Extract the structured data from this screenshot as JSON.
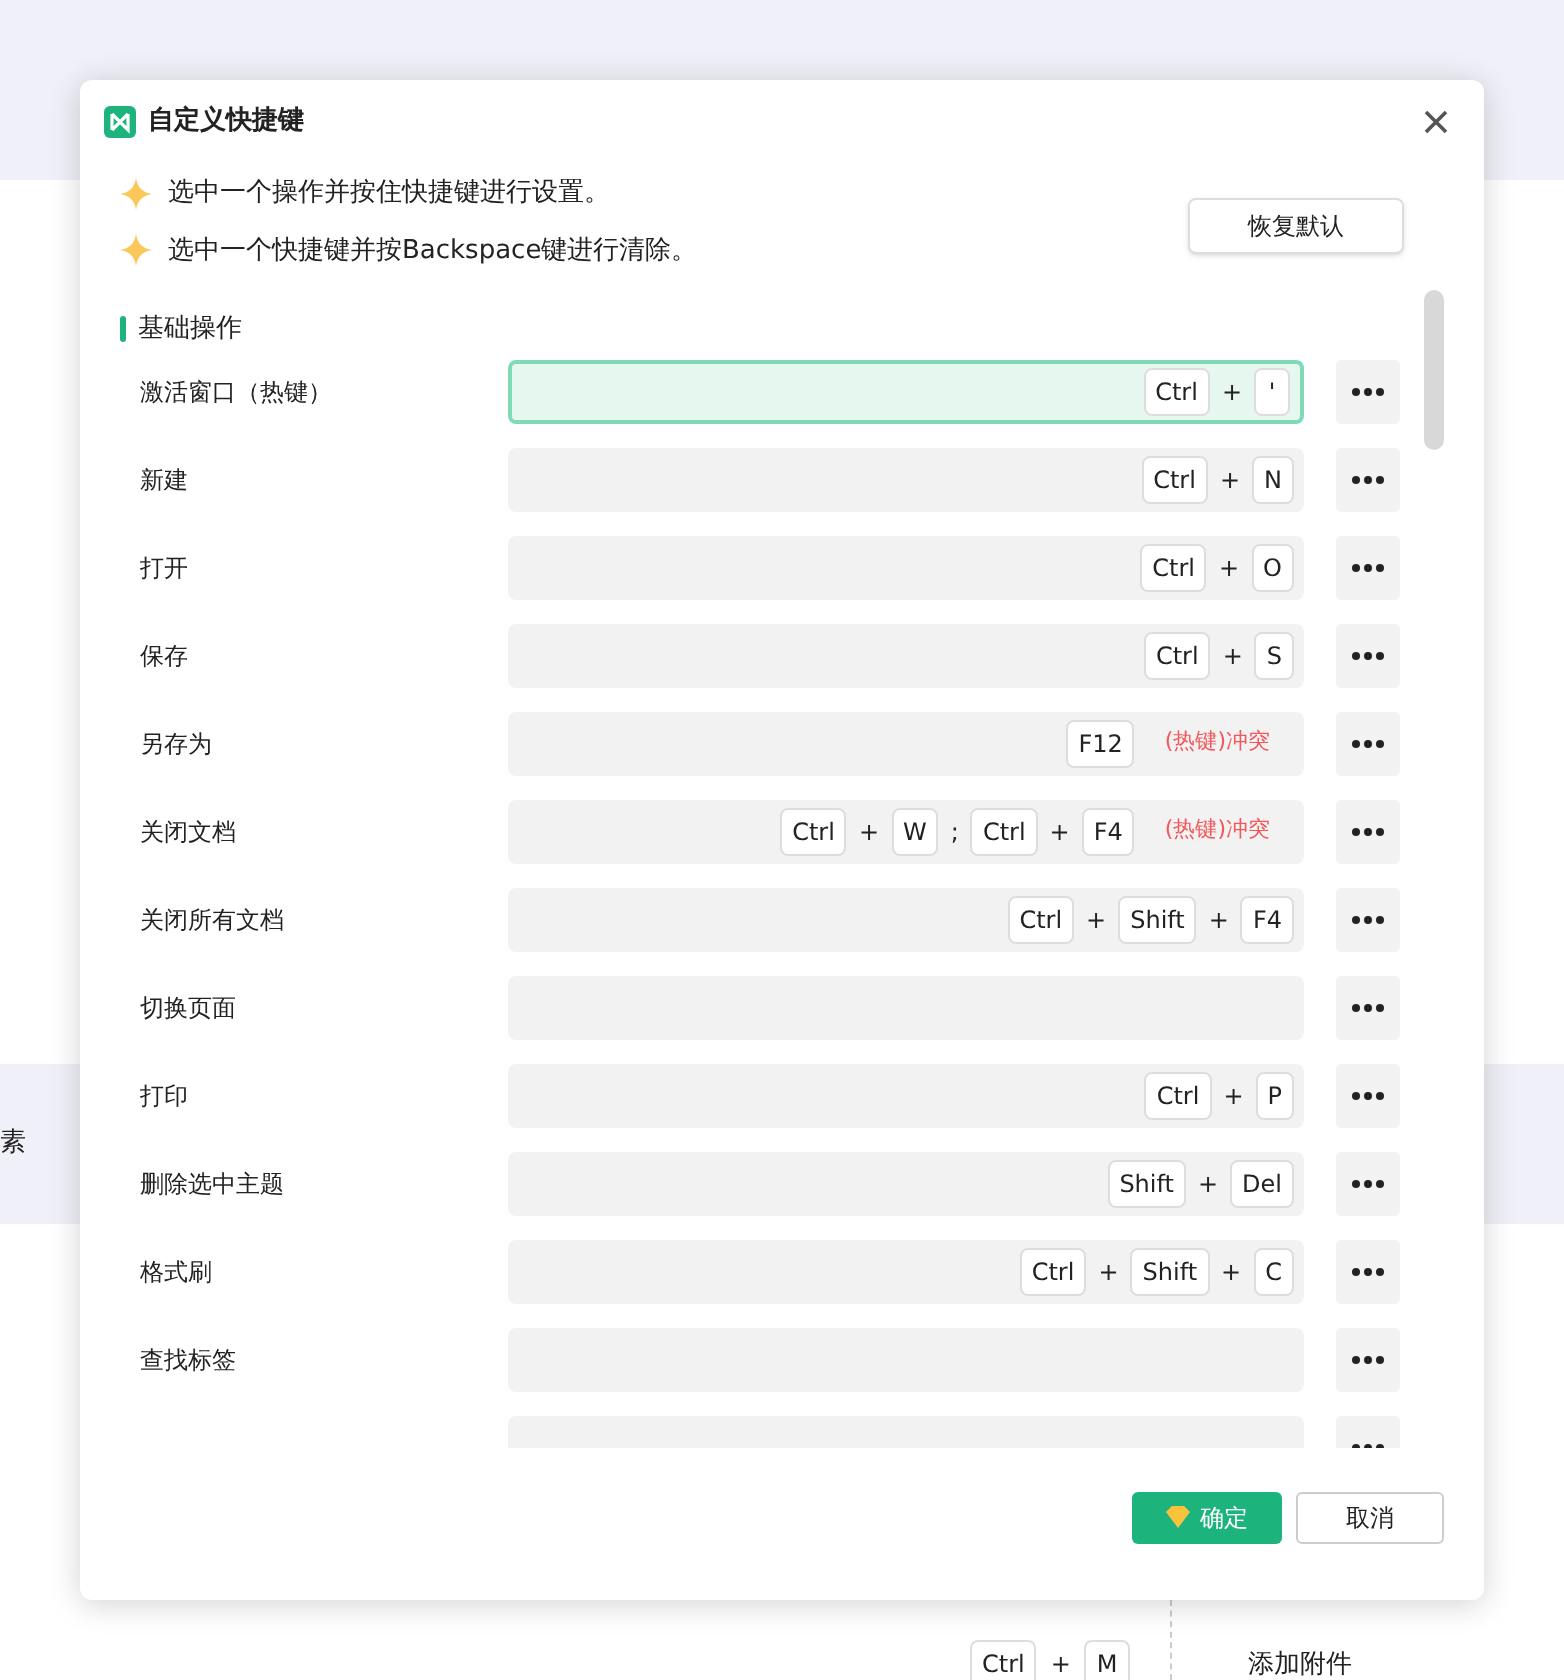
{
  "background": {
    "side_text": "素",
    "keys": [
      {
        "kind": "key",
        "text": "Ctrl"
      },
      {
        "kind": "sep",
        "text": "+"
      },
      {
        "kind": "key",
        "text": "M"
      }
    ],
    "menu_item": "添加附件"
  },
  "dialog": {
    "title": "自定义快捷键",
    "hints": [
      "选中一个操作并按住快捷键进行设置。",
      "选中一个快捷键并按Backspace键进行清除。"
    ],
    "restore_button": "恢复默认",
    "section": "基础操作",
    "shortcuts": [
      {
        "label": "激活窗口（热键）",
        "selected": true,
        "tokens": [
          {
            "kind": "key",
            "text": "Ctrl"
          },
          {
            "kind": "sep",
            "text": "+"
          },
          {
            "kind": "key",
            "text": "'"
          }
        ]
      },
      {
        "label": "新建",
        "selected": false,
        "tokens": [
          {
            "kind": "key",
            "text": "Ctrl"
          },
          {
            "kind": "sep",
            "text": "+"
          },
          {
            "kind": "key",
            "text": "N"
          }
        ]
      },
      {
        "label": "打开",
        "selected": false,
        "tokens": [
          {
            "kind": "key",
            "text": "Ctrl"
          },
          {
            "kind": "sep",
            "text": "+"
          },
          {
            "kind": "key",
            "text": "O"
          }
        ]
      },
      {
        "label": "保存",
        "selected": false,
        "tokens": [
          {
            "kind": "key",
            "text": "Ctrl"
          },
          {
            "kind": "sep",
            "text": "+"
          },
          {
            "kind": "key",
            "text": "S"
          }
        ]
      },
      {
        "label": "另存为",
        "selected": false,
        "tokens": [
          {
            "kind": "key",
            "text": "F12"
          }
        ],
        "conflict": "(热键)冲突"
      },
      {
        "label": "关闭文档",
        "selected": false,
        "tokens": [
          {
            "kind": "key",
            "text": "Ctrl"
          },
          {
            "kind": "sep",
            "text": "+"
          },
          {
            "kind": "key",
            "text": "W"
          },
          {
            "kind": "sep",
            "text": ";"
          },
          {
            "kind": "key",
            "text": "Ctrl"
          },
          {
            "kind": "sep",
            "text": "+"
          },
          {
            "kind": "key",
            "text": "F4"
          }
        ],
        "conflict": "(热键)冲突"
      },
      {
        "label": "关闭所有文档",
        "selected": false,
        "tokens": [
          {
            "kind": "key",
            "text": "Ctrl"
          },
          {
            "kind": "sep",
            "text": "+"
          },
          {
            "kind": "key",
            "text": "Shift"
          },
          {
            "kind": "sep",
            "text": "+"
          },
          {
            "kind": "key",
            "text": "F4"
          }
        ]
      },
      {
        "label": "切换页面",
        "selected": false
      },
      {
        "label": "打印",
        "selected": false,
        "tokens": [
          {
            "kind": "key",
            "text": "Ctrl"
          },
          {
            "kind": "sep",
            "text": "+"
          },
          {
            "kind": "key",
            "text": "P"
          }
        ]
      },
      {
        "label": "删除选中主题",
        "selected": false,
        "tokens": [
          {
            "kind": "key",
            "text": "Shift"
          },
          {
            "kind": "sep",
            "text": "+"
          },
          {
            "kind": "key",
            "text": "Del"
          }
        ]
      },
      {
        "label": "格式刷",
        "selected": false,
        "tokens": [
          {
            "kind": "key",
            "text": "Ctrl"
          },
          {
            "kind": "sep",
            "text": "+"
          },
          {
            "kind": "key",
            "text": "Shift"
          },
          {
            "kind": "sep",
            "text": "+"
          },
          {
            "kind": "key",
            "text": "C"
          }
        ]
      },
      {
        "label": "查找标签",
        "selected": false
      },
      {
        "selected": false
      }
    ],
    "ok_button": "确定",
    "cancel_button": "取消"
  }
}
